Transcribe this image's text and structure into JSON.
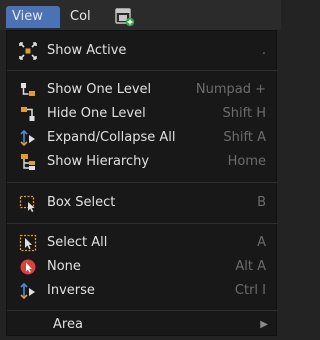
{
  "menubar": {
    "view_label": "View",
    "col_label": "Col"
  },
  "menu": {
    "items": [
      {
        "label": "Show Active",
        "shortcut": "."
      },
      {
        "label": "Show One Level",
        "shortcut": "Numpad +"
      },
      {
        "label": "Hide One Level",
        "shortcut": "Shift H"
      },
      {
        "label": "Expand/Collapse All",
        "shortcut": "Shift A"
      },
      {
        "label": "Show Hierarchy",
        "shortcut": "Home"
      },
      {
        "label": "Box Select",
        "shortcut": "B"
      },
      {
        "label": "Select All",
        "shortcut": "A"
      },
      {
        "label": "None",
        "shortcut": "Alt A"
      },
      {
        "label": "Inverse",
        "shortcut": "Ctrl I"
      },
      {
        "label": "Area",
        "shortcut": ""
      }
    ]
  },
  "colors": {
    "menubar_active": "#4a72b5",
    "menu_bg": "#181818",
    "icon_orange": "#e39b2f",
    "icon_blue": "#4a8be0",
    "icon_red": "#d9443a"
  }
}
